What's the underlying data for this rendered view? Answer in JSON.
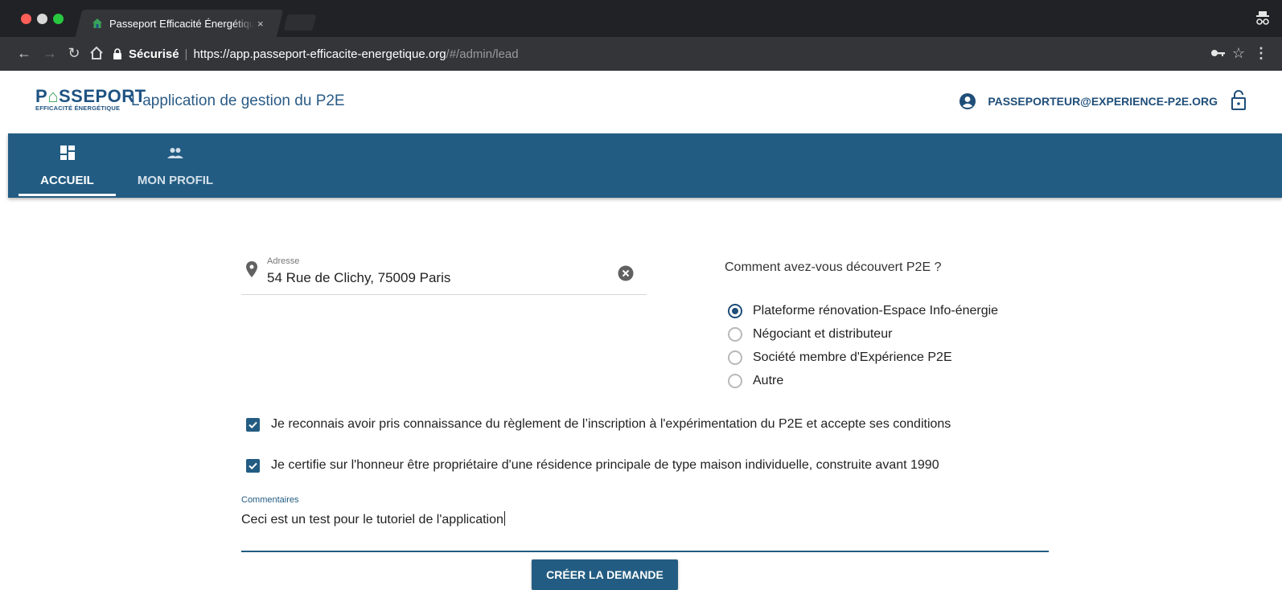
{
  "browser": {
    "tab_title": "Passeport Efficacité Énergétique",
    "tab_close": "×",
    "secure_label": "Sécurisé",
    "url_host": "https://app.passeport-efficacite-energetique.org",
    "url_path": "/#/admin/lead",
    "icons": [
      "back-icon",
      "forward-icon",
      "reload-icon",
      "home-icon",
      "lock-icon",
      "key-icon",
      "star-icon",
      "menu-icon",
      "incognito-icon"
    ]
  },
  "header": {
    "logo_top_a": "P",
    "logo_top_b": "SSEPORT",
    "logo_sub": "EFFICACITÉ ÉNERGÉTIQUE",
    "app_title": "L'application de gestion du P2E",
    "user_email": "PASSEPORTEUR@EXPERIENCE-P2E.ORG"
  },
  "nav": {
    "tabs": [
      {
        "label": "ACCUEIL",
        "icon": "dashboard-icon",
        "active": true
      },
      {
        "label": "MON PROFIL",
        "icon": "people-icon",
        "active": false
      }
    ]
  },
  "form": {
    "address": {
      "label": "Adresse",
      "value": "54 Rue de Clichy, 75009 Paris"
    },
    "question": "Comment avez-vous découvert P2E ?",
    "options": [
      {
        "label": "Plateforme rénovation-Espace Info-énergie",
        "selected": true
      },
      {
        "label": "Négociant et distributeur",
        "selected": false
      },
      {
        "label": "Société membre d'Expérience P2E",
        "selected": false
      },
      {
        "label": "Autre",
        "selected": false
      }
    ],
    "checks": [
      {
        "label": "Je reconnais avoir pris connaissance du règlement de l’inscription à l'expérimentation du P2E et accepte ses conditions",
        "checked": true
      },
      {
        "label": "Je certifie sur l'honneur être propriétaire d'une résidence principale de type maison individuelle, construite avant 1990",
        "checked": true
      }
    ],
    "comment": {
      "label": "Commentaires",
      "value": "Ceci est un test pour le tutoriel de l'application"
    },
    "submit_label": "CRÉER LA DEMANDE"
  },
  "colors": {
    "primary": "#235c82",
    "accent_green": "#3aa15a",
    "chrome_dark": "#212225",
    "chrome_toolbar": "#343539"
  }
}
